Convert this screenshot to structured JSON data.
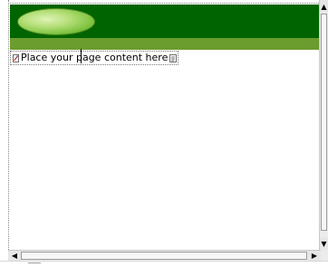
{
  "editor": {
    "placeholder_text": "Place your page content here"
  },
  "icons": {
    "tag_open": "content-tag-open-icon",
    "tag_close": "content-tag-close-icon",
    "scroll_up": "arrow-up-icon",
    "scroll_down": "arrow-down-icon",
    "scroll_left": "arrow-left-icon",
    "scroll_right": "arrow-right-icon"
  },
  "colors": {
    "header_dark_green": "#006400",
    "header_light_green": "#6a9c2e",
    "oval_highlight": "#b5df78"
  },
  "scrollbars": {
    "up_glyph": "▲",
    "down_glyph": "▼",
    "left_glyph": "◀",
    "right_glyph": "▶"
  }
}
